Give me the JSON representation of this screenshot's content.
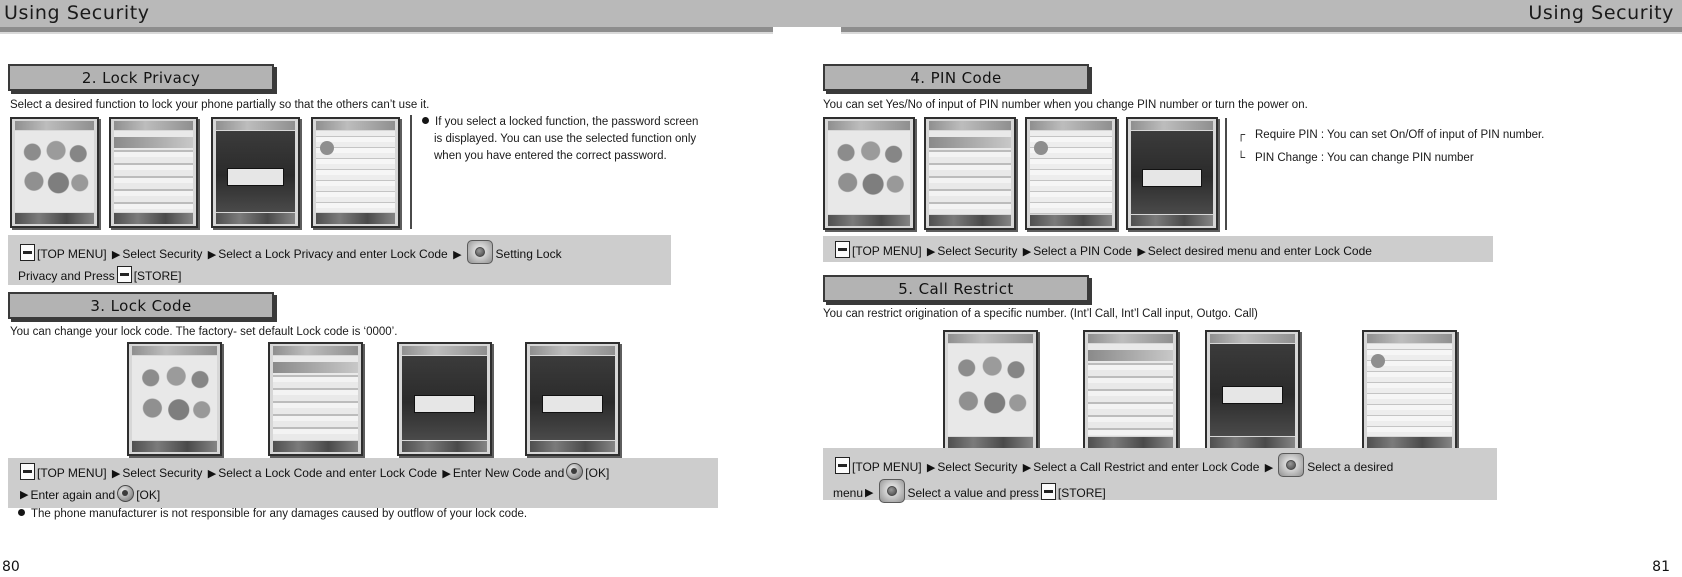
{
  "left_page": {
    "header_title": "Using Security",
    "folio": "80",
    "sections": [
      {
        "plate": "2. Lock Privacy",
        "intro": "Select a desired function to lock your phone partially so that the others can’t use it.",
        "note": {
          "lines": [
            "If you select a locked function, the password screen",
            "is displayed. You can use the selected function only",
            "when you have entered the correct password."
          ]
        },
        "instruction": {
          "line1_a": "[TOP MENU]",
          "line1_b": "Select Security",
          "line1_c": "Select a Lock Privacy and enter Lock Code",
          "line1_d": "Setting Lock",
          "line2_a": "Privacy and Press",
          "line2_b": "[STORE]"
        },
        "shots": [
          "main-menu-screen",
          "security-list-screen",
          "lock-code-entry-screen",
          "lock-privacy-list-screen"
        ]
      },
      {
        "plate": "3. Lock Code",
        "intro": "You can change your lock code. The factory- set default Lock code is ‘0000’.",
        "instruction": {
          "line1_a": "[TOP MENU]",
          "line1_b": "Select Security",
          "line1_c": "Select a Lock Code and enter Lock Code",
          "line1_d": "Enter New Code and",
          "line1_e": "[OK]",
          "line2_a": "Enter again and",
          "line2_b": "[OK]"
        },
        "footnote": "The phone manufacturer is not responsible for any damages caused by outflow of your lock code.",
        "shots": [
          "main-menu-screen",
          "security-list-screen",
          "new-code-entry-screen",
          "reenter-code-screen"
        ]
      }
    ]
  },
  "right_page": {
    "header_title": "Using Security",
    "folio": "81",
    "sections": [
      {
        "plate": "4. PIN Code",
        "intro": "You can set Yes/No of input of PIN number when you change PIN number or turn the power on.",
        "bracket_items": [
          "Require PIN : You can set On/Off of input of PIN number.",
          "PIN Change : You can change PIN number"
        ],
        "instruction": {
          "line1_a": "[TOP MENU]",
          "line1_b": "Select Security",
          "line1_c": "Select a PIN Code",
          "line1_d": "Select desired menu and enter Lock Code"
        },
        "shots": [
          "main-menu-screen",
          "security-list-screen",
          "pin-code-menu-screen",
          "pin-entry-screen"
        ]
      },
      {
        "plate": "5. Call Restrict",
        "intro": "You can restrict origination of a specific number. (Int’l Call, Int’l Call input, Outgo. Call)",
        "instruction": {
          "line1_a": "[TOP MENU]",
          "line1_b": "Select Security",
          "line1_c": "Select a Call Restrict and enter Lock Code",
          "line1_d": "Select a desired",
          "line2_a": "menu",
          "line2_b": "Select a value and press",
          "line2_c": "[STORE]"
        },
        "shots": [
          "main-menu-screen",
          "security-list-screen",
          "call-restrict-entry-screen",
          "call-restrict-option-screen"
        ]
      }
    ]
  },
  "glyphs": {
    "arrow": "▶",
    "bullet": "●"
  }
}
